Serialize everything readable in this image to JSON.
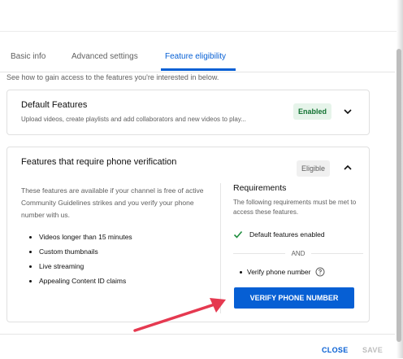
{
  "tabs": [
    {
      "label": "Basic info"
    },
    {
      "label": "Advanced settings"
    },
    {
      "label": "Feature eligibility",
      "active": true
    }
  ],
  "intro": "See how to gain access to the features you're interested in below.",
  "default_card": {
    "title": "Default Features",
    "subtitle": "Upload videos, create playlists and add collaborators and new videos to play...",
    "badge": "Enabled",
    "icon": "chevron-down-icon"
  },
  "phone_card": {
    "title": "Features that require phone verification",
    "badge": "Eligible",
    "icon": "chevron-up-icon",
    "description": "These features are available if your channel is free of active Community Guidelines strikes and you verify your phone number with us.",
    "features": [
      "Videos longer than 15 minutes",
      "Custom thumbnails",
      "Live streaming",
      "Appealing Content ID claims"
    ],
    "requirements": {
      "title": "Requirements",
      "description": "The following requirements must be met to access these features.",
      "met": "Default features enabled",
      "separator": "AND",
      "pending": "Verify phone number",
      "help_icon": "help-circle-icon"
    },
    "verify_button": "VERIFY PHONE NUMBER"
  },
  "footer": {
    "close": "CLOSE",
    "save": "SAVE"
  },
  "colors": {
    "accent": "#065fd4",
    "enabled_bg": "#e6f4ea",
    "enabled_text": "#137333",
    "check": "#1e8e3e",
    "annotation_arrow": "#e53950"
  }
}
